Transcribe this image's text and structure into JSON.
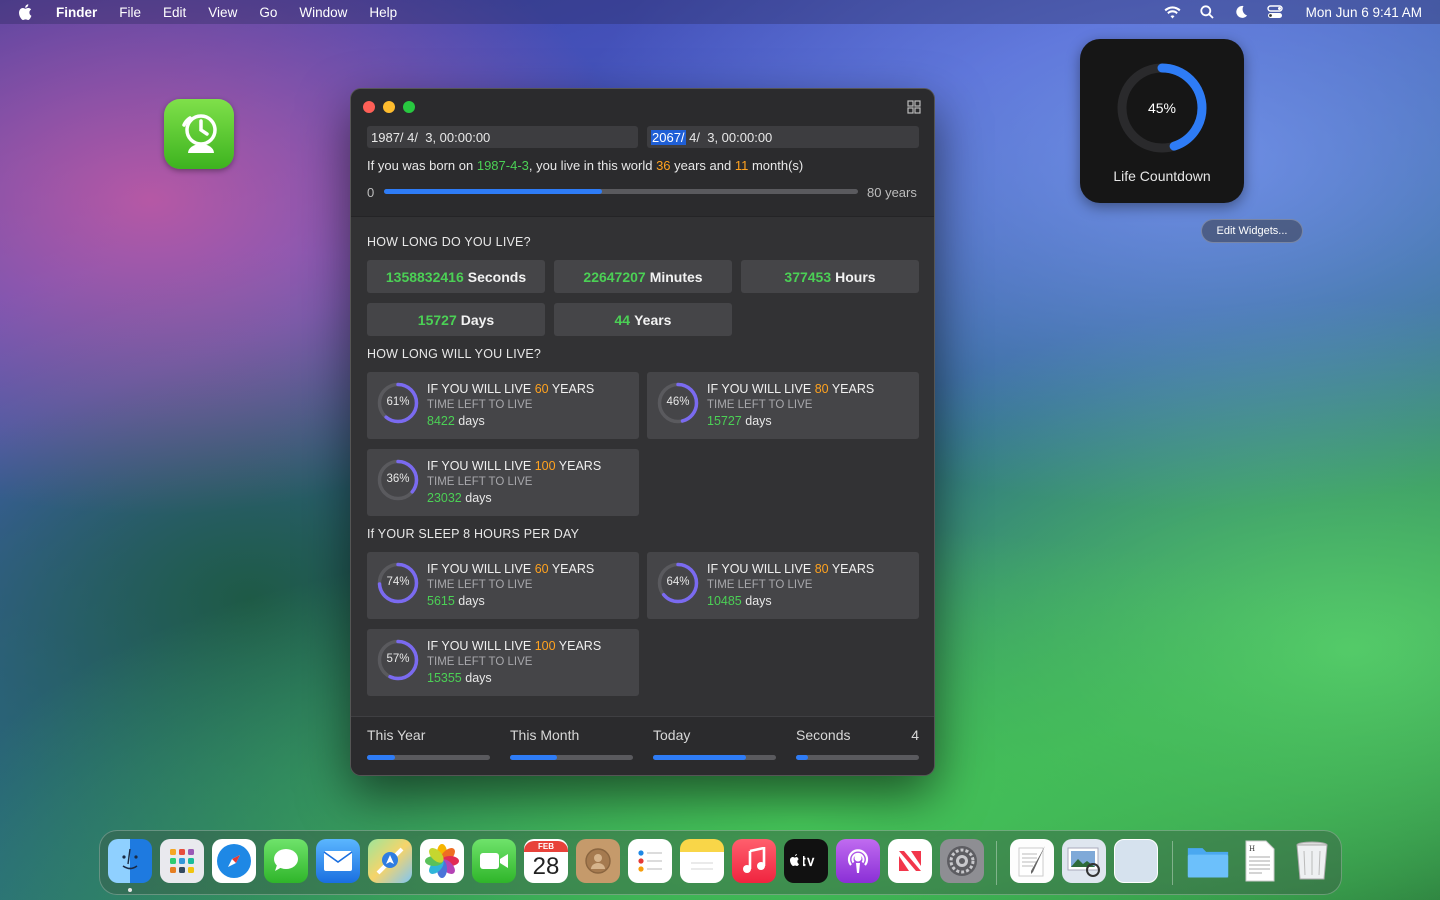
{
  "menubar": {
    "app_name": "Finder",
    "items": [
      "File",
      "Edit",
      "View",
      "Go",
      "Window",
      "Help"
    ],
    "clock": "Mon Jun 6  9:41 AM"
  },
  "widget": {
    "percent_label": "45%",
    "progress": 0.45,
    "title": "Life Countdown",
    "edit_label": "Edit Widgets..."
  },
  "window": {
    "start_date": {
      "year": "1987/",
      "rest": " 4/  3, 00:00:00"
    },
    "end_date": {
      "year": "2067/",
      "rest": " 4/  3, 00:00:00"
    },
    "born": {
      "p1": "If you was born on ",
      "date": "1987-4-3",
      "p2": ", you live in this world ",
      "years": "36",
      "p3": " years and ",
      "months": "11",
      "p4": " month(s)"
    },
    "range": {
      "min_label": "0",
      "max_label": "80 years",
      "progress": 0.46
    },
    "how_long_title": "HOW LONG DO YOU LIVE?",
    "stats": [
      {
        "value": "1358832416",
        "unit": "Seconds"
      },
      {
        "value": "22647207",
        "unit": "Minutes"
      },
      {
        "value": "377453",
        "unit": "Hours"
      },
      {
        "value": "15727",
        "unit": "Days"
      },
      {
        "value": "44",
        "unit": "Years"
      }
    ],
    "will_live_title": "HOW LONG WILL YOU LIVE?",
    "will_live_cards": [
      {
        "pct": "61%",
        "progress": 0.61,
        "pre": "IF YOU WILL LIVE ",
        "years": "60",
        "post": " YEARS",
        "sub": "TIME LEFT TO LIVE",
        "days": "8422",
        "unit": " days"
      },
      {
        "pct": "46%",
        "progress": 0.46,
        "pre": "IF YOU WILL LIVE ",
        "years": "80",
        "post": " YEARS",
        "sub": "TIME LEFT TO LIVE",
        "days": "15727",
        "unit": " days"
      },
      {
        "pct": "36%",
        "progress": 0.36,
        "pre": "IF YOU WILL LIVE ",
        "years": "100",
        "post": " YEARS",
        "sub": "TIME LEFT TO LIVE",
        "days": "23032",
        "unit": " days"
      }
    ],
    "sleep_title": "If YOUR SLEEP 8 HOURS PER DAY",
    "sleep_cards": [
      {
        "pct": "74%",
        "progress": 0.74,
        "pre": "IF YOU WILL LIVE ",
        "years": "60",
        "post": " YEARS",
        "sub": "TIME LEFT TO LIVE",
        "days": "5615",
        "unit": " days"
      },
      {
        "pct": "64%",
        "progress": 0.64,
        "pre": "IF YOU WILL LIVE ",
        "years": "80",
        "post": " YEARS",
        "sub": "TIME LEFT TO LIVE",
        "days": "10485",
        "unit": " days"
      },
      {
        "pct": "57%",
        "progress": 0.57,
        "pre": "IF YOU WILL LIVE ",
        "years": "100",
        "post": " YEARS",
        "sub": "TIME LEFT TO LIVE",
        "days": "15355",
        "unit": " days"
      }
    ],
    "periods": [
      {
        "label": "This Year",
        "value": "",
        "progress": 0.23
      },
      {
        "label": "This Month",
        "value": "",
        "progress": 0.38
      },
      {
        "label": "Today",
        "value": "",
        "progress": 0.76
      },
      {
        "label": "Seconds",
        "value": "4",
        "progress": 0.1
      }
    ]
  },
  "dock": {
    "calendar_month": "FEB",
    "calendar_day": "28",
    "apps": [
      "finder-icon",
      "launchpad-icon",
      "safari-icon",
      "messages-icon",
      "mail-icon",
      "maps-icon",
      "photos-icon",
      "facetime-icon",
      "calendar-icon",
      "contacts-icon",
      "reminders-icon",
      "notes-icon",
      "music-icon",
      "tv-icon",
      "podcasts-icon",
      "news-icon",
      "system-settings-icon",
      "textedit-icon",
      "preview-icon",
      "blank-app-icon",
      "folder-icon",
      "document-icon",
      "trash-icon"
    ]
  },
  "colors": {
    "accent": "#2e7cf6",
    "green": "#4bd055",
    "orange": "#ffa21f"
  }
}
